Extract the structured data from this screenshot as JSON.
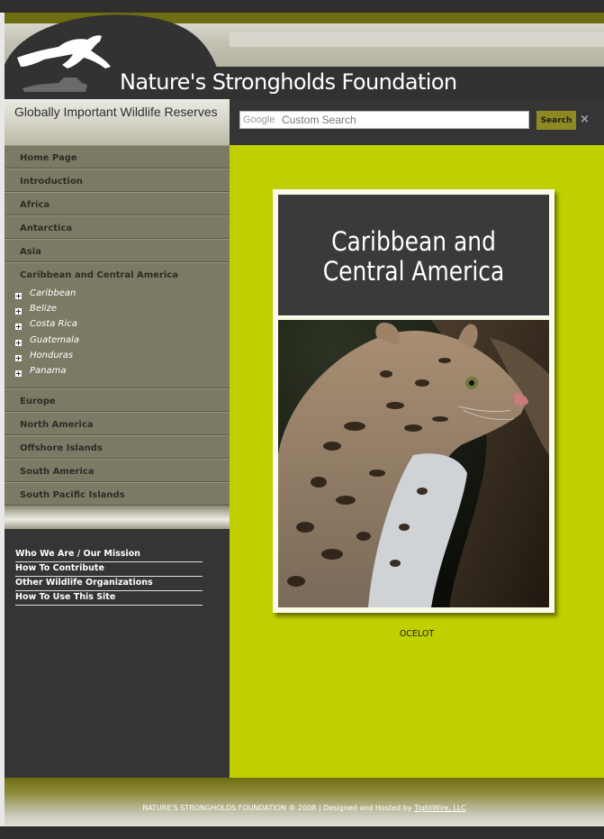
{
  "header": {
    "site_title": "Nature's Strongholds Foundation",
    "tagline": "Globally Important Wildlife Reserves"
  },
  "search": {
    "brand": "Google",
    "placeholder": "Custom Search",
    "button_label": "Search",
    "clear_label": "×"
  },
  "sidebar": {
    "nav": [
      {
        "label": "Home Page"
      },
      {
        "label": "Introduction"
      },
      {
        "label": "Africa"
      },
      {
        "label": "Antarctica"
      },
      {
        "label": "Asia"
      },
      {
        "label": "Caribbean and Central America"
      },
      {
        "label": "Europe"
      },
      {
        "label": "North America"
      },
      {
        "label": "Offshore Islands"
      },
      {
        "label": "South America"
      },
      {
        "label": "South Pacific Islands"
      }
    ],
    "subnav": [
      {
        "label": "Caribbean"
      },
      {
        "label": "Belize"
      },
      {
        "label": "Costa Rica"
      },
      {
        "label": "Guatemala"
      },
      {
        "label": "Honduras"
      },
      {
        "label": "Panama"
      }
    ],
    "about_links": [
      {
        "label": "Who We Are / Our Mission"
      },
      {
        "label": "How To Contribute"
      },
      {
        "label": "Other Wildlife Organizations"
      },
      {
        "label": "How To Use This Site"
      }
    ]
  },
  "main": {
    "heading_line1": "Caribbean and",
    "heading_line2": "Central America",
    "caption": "OCELOT"
  },
  "footer": {
    "text": "NATURE'S STRONGHOLDS FOUNDATION ® 2008 | Designed and Hosted by ",
    "link_label": "TightWire, LLC"
  },
  "colors": {
    "main_bg": "#bfcf00",
    "nav_bg": "#7c7a65",
    "dark": "#353535",
    "olive": "#6f6d12"
  }
}
